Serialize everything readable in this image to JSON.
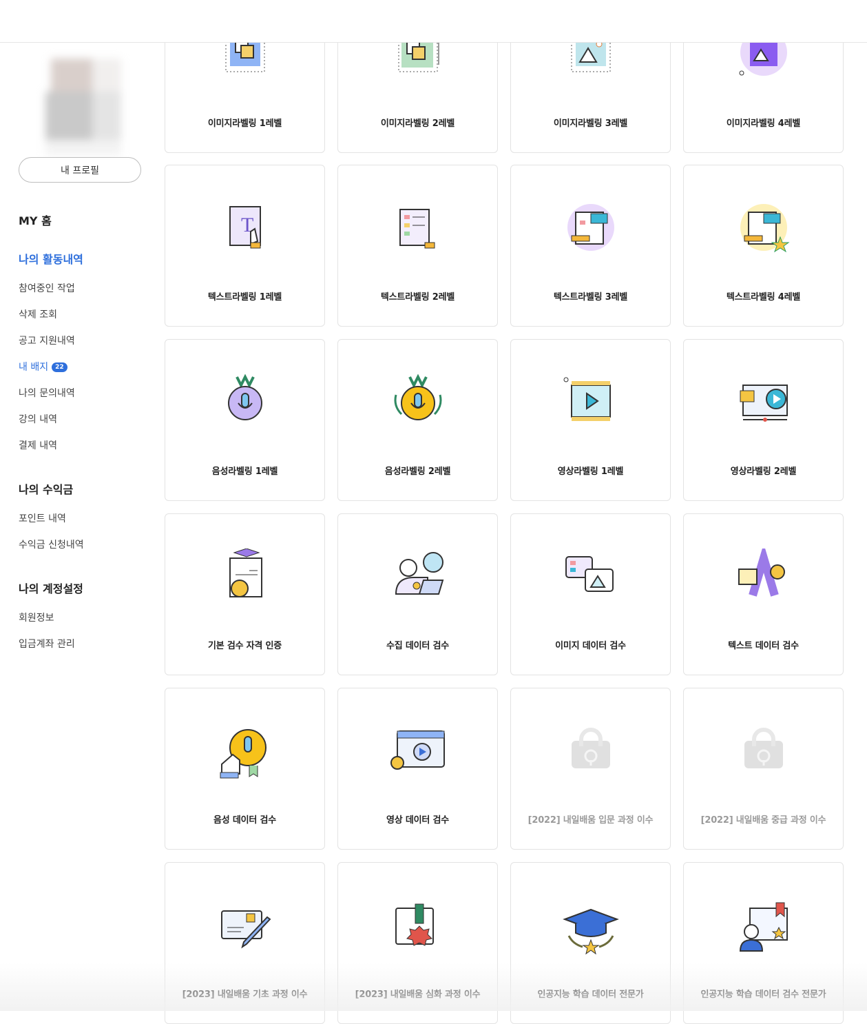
{
  "sidebar": {
    "profile_button": "내 프로필",
    "my_home": "MY 홈",
    "activity": {
      "heading": "나의 활동내역",
      "items": [
        "참여중인 작업",
        "삭제 조회",
        "공고 지원내역",
        "내 배지",
        "나의 문의내역",
        "강의 내역",
        "결제 내역"
      ],
      "badge_count": "22"
    },
    "earnings": {
      "heading": "나의 수익금",
      "items": [
        "포인트 내역",
        "수익금 신청내역"
      ]
    },
    "account": {
      "heading": "나의 계정설정",
      "items": [
        "회원정보",
        "입금계좌 관리"
      ]
    }
  },
  "badges": [
    {
      "label": "이미지라벨링 1레벨",
      "icon": "image-labeling-1-icon",
      "locked": false
    },
    {
      "label": "이미지라벨링 2레벨",
      "icon": "image-labeling-2-icon",
      "locked": false
    },
    {
      "label": "이미지라벨링 3레벨",
      "icon": "image-labeling-3-icon",
      "locked": false
    },
    {
      "label": "이미지라벨링 4레벨",
      "icon": "image-labeling-4-icon",
      "locked": false
    },
    {
      "label": "텍스트라벨링 1레벨",
      "icon": "text-labeling-1-icon",
      "locked": false
    },
    {
      "label": "텍스트라벨링 2레벨",
      "icon": "text-labeling-2-icon",
      "locked": false
    },
    {
      "label": "텍스트라벨링 3레벨",
      "icon": "text-labeling-3-icon",
      "locked": false
    },
    {
      "label": "텍스트라벨링 4레벨",
      "icon": "text-labeling-4-icon",
      "locked": false
    },
    {
      "label": "음성라벨링 1레벨",
      "icon": "voice-labeling-1-icon",
      "locked": false
    },
    {
      "label": "음성라벨링 2레벨",
      "icon": "voice-labeling-2-icon",
      "locked": false
    },
    {
      "label": "영상라벨링 1레벨",
      "icon": "video-labeling-1-icon",
      "locked": false
    },
    {
      "label": "영상라벨링 2레벨",
      "icon": "video-labeling-2-icon",
      "locked": false
    },
    {
      "label": "기본 검수 자격 인증",
      "icon": "certificate-icon",
      "locked": false
    },
    {
      "label": "수집 데이터 검수",
      "icon": "collect-inspect-icon",
      "locked": false
    },
    {
      "label": "이미지 데이터 검수",
      "icon": "image-inspect-icon",
      "locked": false
    },
    {
      "label": "텍스트 데이터 검수",
      "icon": "text-inspect-icon",
      "locked": false
    },
    {
      "label": "음성 데이터 검수",
      "icon": "voice-inspect-icon",
      "locked": false
    },
    {
      "label": "영상 데이터 검수",
      "icon": "video-inspect-icon",
      "locked": false
    },
    {
      "label": "[2022] 내일배움 입문 과정 이수",
      "icon": "lock-icon",
      "locked": true
    },
    {
      "label": "[2022] 내일배움 중급 과정 이수",
      "icon": "lock-icon",
      "locked": true
    },
    {
      "label": "[2023] 내일배움 기초 과정 이수",
      "icon": "certificate-pencil-icon",
      "locked": false
    },
    {
      "label": "[2023] 내일배움 심화 과정 이수",
      "icon": "certificate-medal-icon",
      "locked": false
    },
    {
      "label": "인공지능 학습 데이터 전문가",
      "icon": "graduation-cap-icon",
      "locked": false
    },
    {
      "label": "인공지능 학습 데이터 검수 전문가",
      "icon": "expert-inspector-icon",
      "locked": false
    }
  ]
}
